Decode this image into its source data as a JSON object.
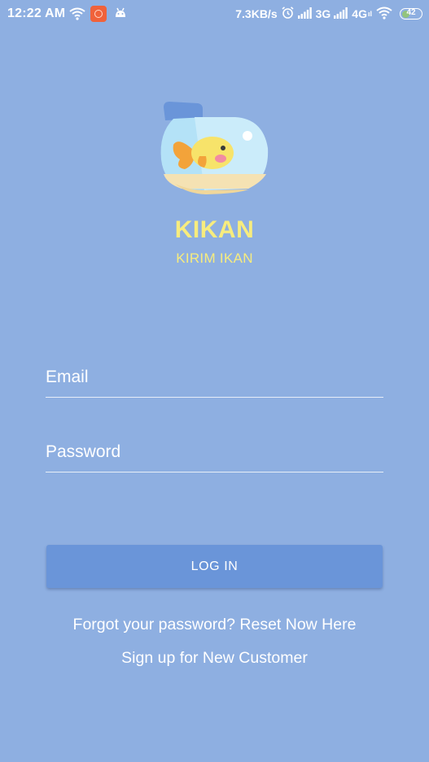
{
  "status_bar": {
    "time": "12:22 AM",
    "net_speed": "7.3KB/s",
    "network_1": "3G",
    "network_2": "4G",
    "network_2_sub": "ıl",
    "battery_level": "42",
    "battery_fraction": 0.42,
    "battery_color": "#93c47d",
    "icons": [
      "wifi-icon",
      "app-notification-icon",
      "android-icon",
      "alarm-icon",
      "signal-icon",
      "signal-icon",
      "wifi-icon",
      "battery-icon"
    ]
  },
  "branding": {
    "logo_icon": "fishbowl-logo",
    "app_name": "KIKAN",
    "tagline": "KIRIM IKAN",
    "accent_color": "#f7ec7e"
  },
  "form": {
    "email_placeholder": "Email",
    "email_value": "",
    "password_placeholder": "Password",
    "password_value": "",
    "login_label": "LOG IN"
  },
  "links": {
    "forgot_password": "Forgot your password? Reset Now Here",
    "sign_up": "Sign up for New Customer"
  },
  "colors": {
    "background": "#8eafe1",
    "button": "#6a95d9"
  }
}
